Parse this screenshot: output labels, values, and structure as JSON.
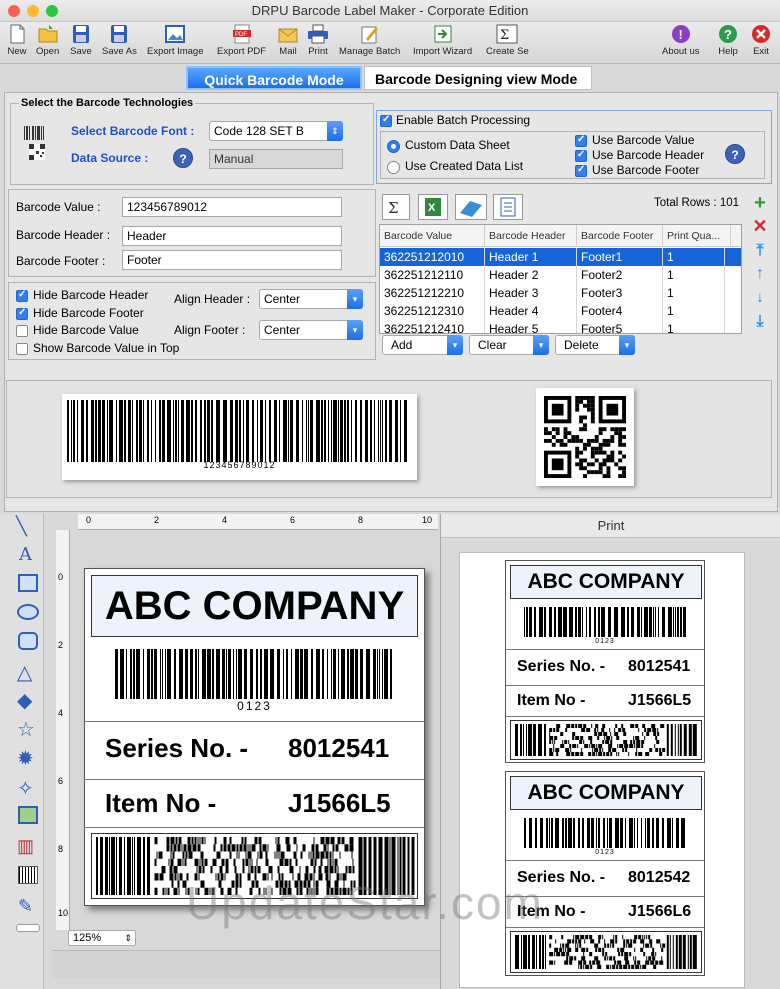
{
  "window": {
    "title": "DRPU Barcode Label Maker - Corporate Edition"
  },
  "toolbar": {
    "new": "New",
    "open": "Open",
    "save": "Save",
    "save_as": "Save As",
    "export_image": "Export Image",
    "export_pdf": "Export PDF",
    "mail": "Mail",
    "print": "Print",
    "manage_batch": "Manage Batch",
    "import_wizard": "Import Wizard",
    "create_series": "Create Se",
    "about": "About us",
    "help": "Help",
    "exit": "Exit"
  },
  "modes": {
    "quick": "Quick Barcode Mode",
    "designing": "Barcode Designing view Mode"
  },
  "technologies": {
    "section_title": "Select the Barcode Technologies",
    "font_label": "Select Barcode Font :",
    "font_value": "Code 128 SET B",
    "source_label": "Data Source :",
    "source_value": "Manual"
  },
  "batch": {
    "enable": "Enable Batch Processing",
    "custom_sheet": "Custom Data Sheet",
    "created_list": "Use Created Data List",
    "use_value": "Use Barcode Value",
    "use_header": "Use Barcode Header",
    "use_footer": "Use Barcode Footer"
  },
  "fields": {
    "value_label": "Barcode Value :",
    "value": "123456789012",
    "header_label": "Barcode Header :",
    "header": "Header",
    "footer_label": "Barcode Footer :",
    "footer": "Footer"
  },
  "options": {
    "hide_header": "Hide Barcode Header",
    "hide_footer": "Hide Barcode Footer",
    "hide_value": "Hide Barcode Value",
    "show_top": "Show Barcode Value in Top",
    "align_header_label": "Align Header :",
    "align_header": "Center",
    "align_footer_label": "Align Footer :",
    "align_footer": "Center"
  },
  "grid": {
    "total_rows": "Total Rows : 101",
    "columns": [
      "Barcode Value",
      "Barcode Header",
      "Barcode Footer",
      "Print Qua..."
    ],
    "rows": [
      [
        "362251212010",
        "Header 1",
        "Footer1",
        "1"
      ],
      [
        "362251212110",
        "Header 2",
        "Footer2",
        "1"
      ],
      [
        "362251212210",
        "Header 3",
        "Footer3",
        "1"
      ],
      [
        "362251212310",
        "Header 4",
        "Footer4",
        "1"
      ],
      [
        "362251212410",
        "Header 5",
        "Footer5",
        "1"
      ]
    ],
    "add": "Add",
    "clear": "Clear",
    "delete": "Delete"
  },
  "preview": {
    "linear_text": "123456789012"
  },
  "designer": {
    "ruler_marks": [
      "0",
      "2",
      "4",
      "6",
      "8",
      "10"
    ],
    "vruler_marks": [
      "0",
      "2",
      "4",
      "6",
      "8",
      "10"
    ],
    "company": "ABC COMPANY",
    "barcode_text": "0123",
    "series_label": "Series No. -",
    "series_value": "8012541",
    "item_label": "Item No -",
    "item_value": "J1566L5",
    "zoom": "125%"
  },
  "print_panel": {
    "title": "Print",
    "labels": [
      {
        "company": "ABC COMPANY",
        "code": "0123",
        "series_label": "Series No. -",
        "series": "8012541",
        "item_label": "Item No -",
        "item": "J1566L5"
      },
      {
        "company": "ABC COMPANY",
        "code": "0123",
        "series_label": "Series No. -",
        "series": "8012542",
        "item_label": "Item No -",
        "item": "J1566L6"
      }
    ]
  },
  "watermark": "UpdateStar.com"
}
